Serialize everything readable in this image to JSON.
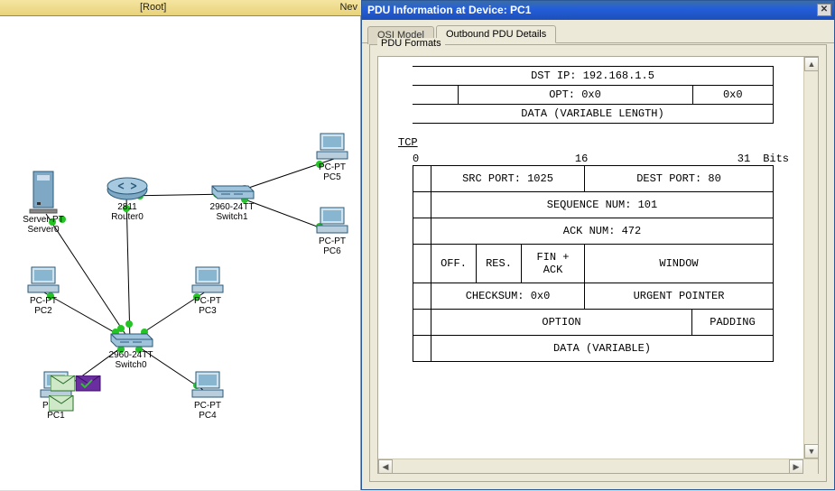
{
  "topbar": {
    "root": "[Root]",
    "nev": "Nev"
  },
  "devices": {
    "server0": {
      "line1": "Server-PT",
      "line2": "Server0"
    },
    "router0": {
      "line1": "2811",
      "line2": "Router0"
    },
    "switch1": {
      "line1": "2960-24TT",
      "line2": "Switch1"
    },
    "switch0": {
      "line1": "2960-24TT",
      "line2": "Switch0"
    },
    "pc1": {
      "line1": "PC-PT",
      "line2": "PC1"
    },
    "pc2": {
      "line1": "PC-PT",
      "line2": "PC2"
    },
    "pc3": {
      "line1": "PC-PT",
      "line2": "PC3"
    },
    "pc4": {
      "line1": "PC-PT",
      "line2": "PC4"
    },
    "pc5": {
      "line1": "PC-PT",
      "line2": "PC5"
    },
    "pc6": {
      "line1": "PC-PT",
      "line2": "PC6"
    }
  },
  "window": {
    "title": "PDU Information at Device: PC1",
    "tabs": {
      "osi": "OSI Model",
      "out": "Outbound PDU Details"
    },
    "group": "PDU Formats"
  },
  "ip": {
    "dst": "DST IP: 192.168.1.5",
    "opt": "OPT: 0x0",
    "pad": "0x0",
    "data": "DATA (VARIABLE LENGTH)"
  },
  "tcp": {
    "label": "TCP",
    "bit0": "0",
    "bit16": "16",
    "bit31": "31",
    "bits": "Bits",
    "src": "SRC PORT: 1025",
    "dst": "DEST PORT: 80",
    "seq": "SEQUENCE NUM: 101",
    "ack": "ACK NUM: 472",
    "off": "OFF.",
    "res": "RES.",
    "flags": "FIN + ACK",
    "win": "WINDOW",
    "chk": "CHECKSUM: 0x0",
    "urg": "URGENT POINTER",
    "opt": "OPTION",
    "pad": "PADDING",
    "data": "DATA (VARIABLE)"
  }
}
